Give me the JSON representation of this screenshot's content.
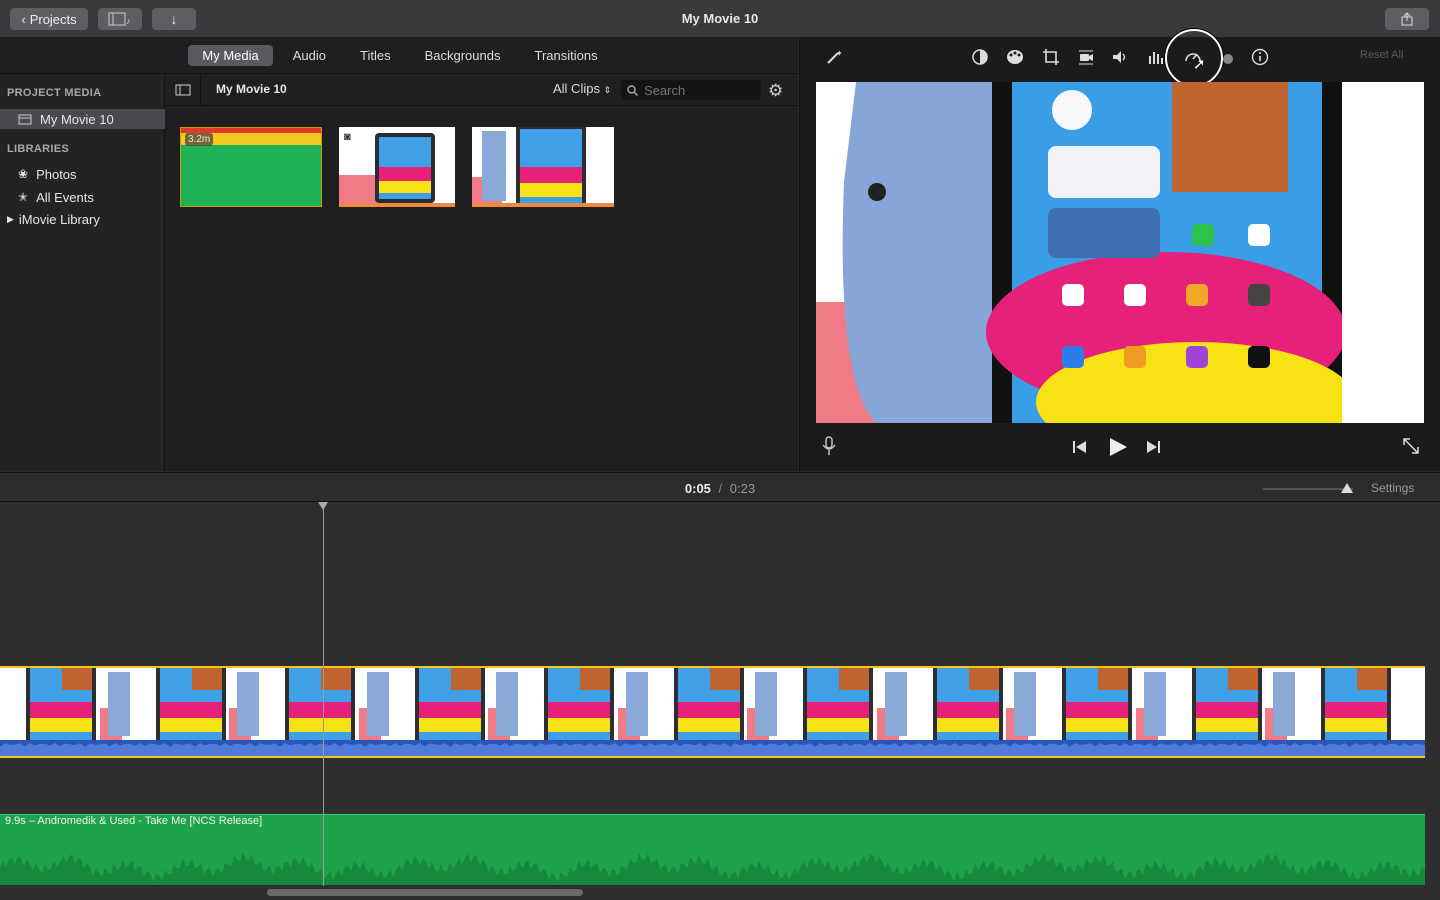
{
  "titlebar": {
    "projects_label": "Projects",
    "title": "My Movie 10"
  },
  "tabs": [
    "My Media",
    "Audio",
    "Titles",
    "Backgrounds",
    "Transitions"
  ],
  "sidebar": {
    "project_media_heading": "PROJECT MEDIA",
    "project_item": "My Movie 10",
    "libraries_heading": "LIBRARIES",
    "photos": "Photos",
    "all_events": "All Events",
    "imovie_library": "iMovie Library"
  },
  "media": {
    "event_title": "My Movie 10",
    "filter": "All Clips",
    "search_placeholder": "Search",
    "clip1_duration": "3.2m"
  },
  "viewer": {
    "reset_all": "Reset All"
  },
  "timeline": {
    "current_time": "0:05",
    "separator": "/",
    "total_time": "0:23",
    "settings": "Settings",
    "audio_clip_label": "9.9s – Andromedik & Used - Take Me [NCS Release]"
  },
  "colors": {
    "accent": "#f5c518",
    "audio_green": "#1fa34a",
    "selected_tab": "#5a5a5e"
  }
}
